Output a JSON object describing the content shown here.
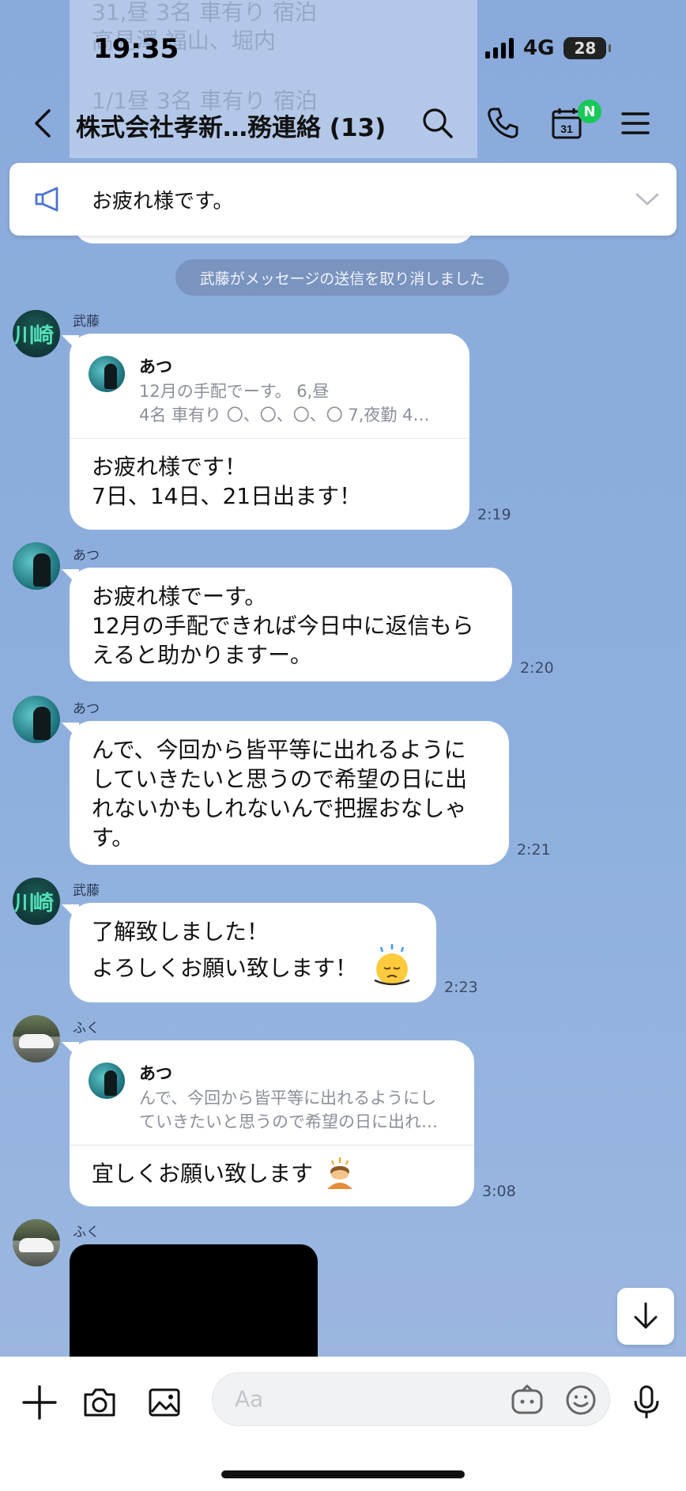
{
  "background_ghost_lines": [
    "31,昼 3名 車有り 宿泊",
    "高見澤 福山、堀内",
    "1/1昼 3名 車有り 宿泊"
  ],
  "status_bar": {
    "time": "19:35",
    "network": "4G",
    "battery": "28"
  },
  "header": {
    "title": "株式会社孝新…務連絡 (13)",
    "calendar_day": "31",
    "calendar_badge": "N"
  },
  "announcement": {
    "text": "お疲れ様です。"
  },
  "system_message": "武藤がメッセージの送信を取り消しました",
  "messages": [
    {
      "sender": "武藤",
      "avatar_text": "川崎",
      "quote": {
        "name": "あつ",
        "line1": "12月の手配でーす。 6,昼",
        "line2": "4名 車有り 〇、〇、〇、〇 7,夜勤 4…"
      },
      "lines": [
        "お疲れ様です！",
        "7日、14日、21日出ます！"
      ],
      "time": "2:19"
    },
    {
      "sender": "あつ",
      "lines": [
        "お疲れ様でーす。",
        "12月の手配できれば今日中に返信もら",
        "えると助かりますー。"
      ],
      "time": "2:20"
    },
    {
      "sender": "あつ",
      "lines": [
        "んで、今回から皆平等に出れるように",
        "していきたいと思うので希望の日に出",
        "れないかもしれないんで把握おなしゃ",
        "す。"
      ],
      "time": "2:21"
    },
    {
      "sender": "武藤",
      "avatar_text": "川崎",
      "lines": [
        "了解致しました！",
        "よろしくお願い致します！"
      ],
      "emoji": "sleepy-face-emoji",
      "time": "2:23"
    },
    {
      "sender": "ふく",
      "quote": {
        "name": "あつ",
        "line1": "んで、今回から皆平等に出れるようにし",
        "line2": "ていきたいと思うので希望の日に出れ…"
      },
      "lines": [
        "宜しくお願い致します"
      ],
      "emoji": "bowing-person-emoji",
      "time": "3:08"
    },
    {
      "sender": "ふく",
      "media": "black-image"
    }
  ],
  "input": {
    "placeholder": "Aa"
  },
  "colors": {
    "chat_background": "#8daedc",
    "bubble": "#ffffff",
    "badge_green": "#18c85a"
  }
}
